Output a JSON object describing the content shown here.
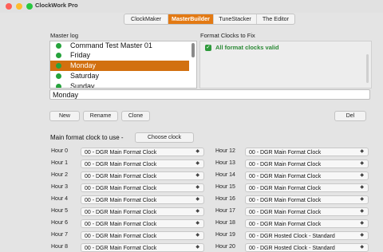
{
  "window": {
    "title": "ClockWork Pro"
  },
  "tabs": [
    {
      "label": "ClockMaker",
      "active": false
    },
    {
      "label": "MasterBuilder",
      "active": true
    },
    {
      "label": "TuneStacker",
      "active": false
    },
    {
      "label": "The Editor",
      "active": false
    }
  ],
  "master_log": {
    "label": "Master log",
    "items": [
      {
        "label": "Command Test Master 01",
        "status": "green",
        "selected": false
      },
      {
        "label": "Friday",
        "status": "green",
        "selected": false
      },
      {
        "label": "Monday",
        "status": "green",
        "selected": true
      },
      {
        "label": "Saturday",
        "status": "green",
        "selected": false
      },
      {
        "label": "Sunday",
        "status": "green",
        "selected": false
      }
    ]
  },
  "format_clocks": {
    "label": "Format Clocks to Fix",
    "status_text": "All format clocks valid"
  },
  "name_field": {
    "value": "Monday"
  },
  "buttons": {
    "new": "New",
    "rename": "Rename",
    "clone": "Clone",
    "del": "Del"
  },
  "main_clock": {
    "label": "Main format clock to use -",
    "choose_button": "Choose clock"
  },
  "hours_left": [
    {
      "label": "Hour 0",
      "value": "00 - DGR Main Format Clock"
    },
    {
      "label": "Hour 1",
      "value": "00 - DGR Main Format Clock"
    },
    {
      "label": "Hour 2",
      "value": "00 - DGR Main Format Clock"
    },
    {
      "label": "Hour 3",
      "value": "00 - DGR Main Format Clock"
    },
    {
      "label": "Hour 4",
      "value": "00 - DGR Main Format Clock"
    },
    {
      "label": "Hour 5",
      "value": "00 - DGR Main Format Clock"
    },
    {
      "label": "Hour 6",
      "value": "00 - DGR Main Format Clock"
    },
    {
      "label": "Hour 7",
      "value": "00 - DGR Main Format Clock"
    },
    {
      "label": "Hour 8",
      "value": "00 - DGR Main Format Clock"
    }
  ],
  "hours_right": [
    {
      "label": "Hour 12",
      "value": "00 - DGR Main Format Clock"
    },
    {
      "label": "Hour 13",
      "value": "00 - DGR Main Format Clock"
    },
    {
      "label": "Hour 14",
      "value": "00 - DGR Main Format Clock"
    },
    {
      "label": "Hour 15",
      "value": "00 - DGR Main Format Clock"
    },
    {
      "label": "Hour 16",
      "value": "00 - DGR Main Format Clock"
    },
    {
      "label": "Hour 17",
      "value": "00 - DGR Main Format Clock"
    },
    {
      "label": "Hour 18",
      "value": "00 - DGR Main Format Clock"
    },
    {
      "label": "Hour 19",
      "value": "00 - DGR Hosted Clock - Standard"
    },
    {
      "label": "Hour 20",
      "value": "00 - DGR Hosted Clock - Standard"
    }
  ],
  "colors": {
    "accent": "#e37a14",
    "valid": "#2c8a36",
    "status_dot": "#26a33c"
  }
}
